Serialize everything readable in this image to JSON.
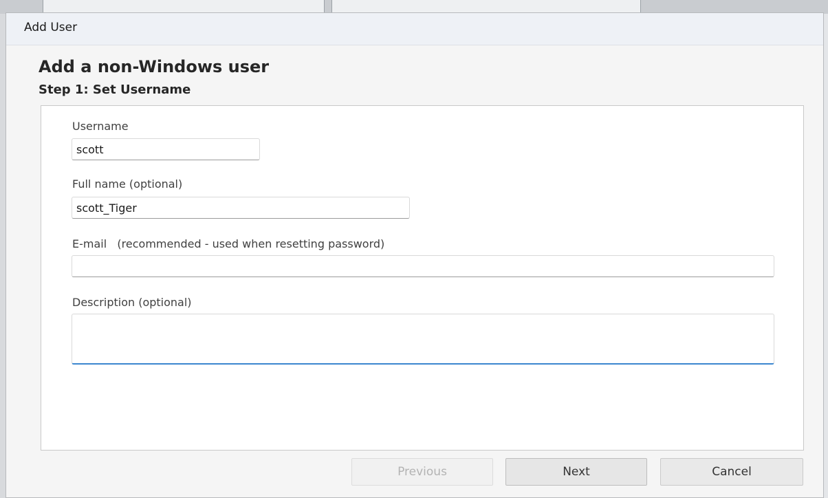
{
  "window": {
    "title": "Add User"
  },
  "wizard": {
    "heading": "Add a non-Windows user",
    "step": "Step 1: Set Username"
  },
  "form": {
    "username": {
      "label": "Username",
      "value": "scott"
    },
    "full_name": {
      "label": "Full name (optional)",
      "value": "scott_Tiger"
    },
    "email": {
      "label": "E-mail   (recommended - used when resetting password)",
      "value": ""
    },
    "description": {
      "label": "Description (optional)",
      "value": ""
    }
  },
  "buttons": {
    "previous": "Previous",
    "next": "Next",
    "cancel": "Cancel"
  },
  "colors": {
    "focus_accent": "#3b86cf",
    "dialog_background": "#f5f5f5",
    "panel_background": "#ffffff"
  }
}
